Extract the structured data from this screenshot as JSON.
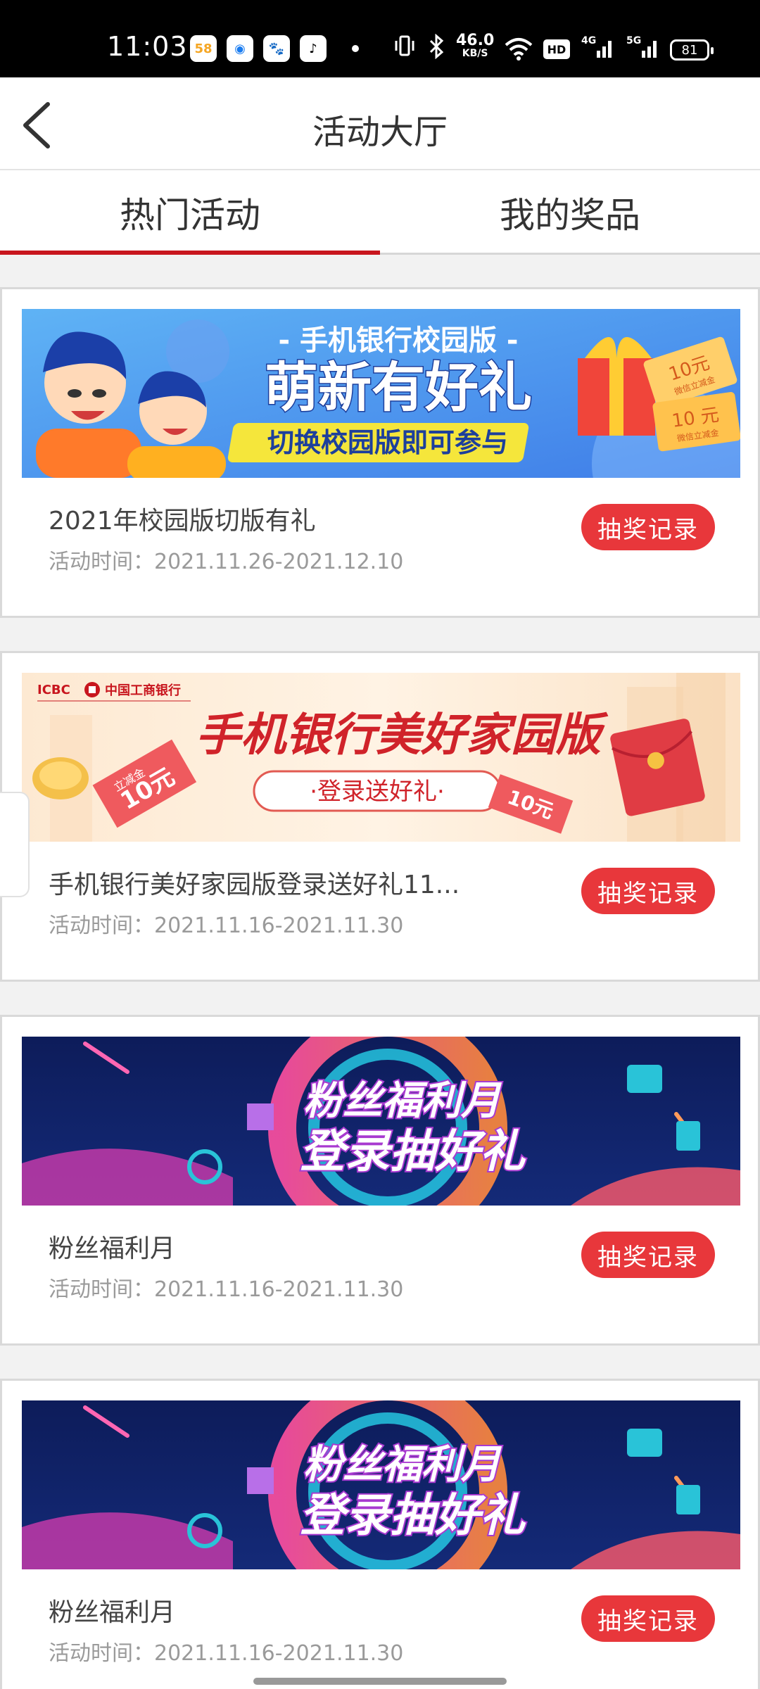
{
  "status_bar": {
    "time": "11:03",
    "apps": [
      "58",
      "◉",
      "🐾",
      "♪"
    ],
    "net_speed_value": "46.0",
    "net_speed_unit": "KB/S",
    "hd_label": "HD",
    "signal_1": "4G",
    "signal_2": "5G",
    "battery": "81"
  },
  "header": {
    "title": "活动大厅"
  },
  "tabs": [
    {
      "label": "热门活动",
      "active": true
    },
    {
      "label": "我的奖品",
      "active": false
    }
  ],
  "accent_color": "#c8161e",
  "button_color": "#e8373b",
  "cards": [
    {
      "title": "2021年校园版切版有礼",
      "time": "活动时间：2021.11.26-2021.12.10",
      "button": "抽奖记录",
      "banner": {
        "line1": "- 手机银行校园版 -",
        "line2": "萌新有好礼",
        "line3": "切换校园版即可参与",
        "ticket1_amount": "10元",
        "ticket1_note": "微信立减金",
        "ticket2_amount": "10 元",
        "ticket2_note": "微信立减金"
      }
    },
    {
      "title": "手机银行美好家园版登录送好礼11...",
      "time": "活动时间：2021.11.16-2021.11.30",
      "button": "抽奖记录",
      "banner": {
        "brand": "ICBC",
        "bank_name": "中国工商银行",
        "headline": "手机银行美好家园版",
        "sub": "·登录送好礼·",
        "coupon_left": "立减金",
        "coupon_left_amount": "10元",
        "coupon_right_amount": "10元"
      }
    },
    {
      "title": "粉丝福利月",
      "time": "活动时间：2021.11.16-2021.11.30",
      "button": "抽奖记录",
      "banner": {
        "line1": "粉丝福利月",
        "line2": "登录抽好礼"
      }
    },
    {
      "title": "粉丝福利月",
      "time": "活动时间：2021.11.16-2021.11.30",
      "button": "抽奖记录",
      "banner": {
        "line1": "粉丝福利月",
        "line2": "登录抽好礼"
      }
    }
  ]
}
